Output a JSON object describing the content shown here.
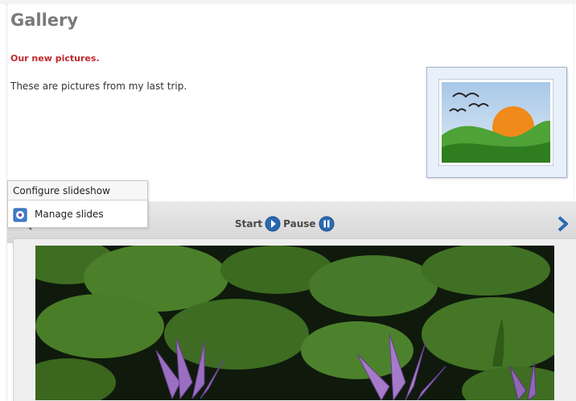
{
  "page": {
    "title": "Gallery",
    "subtitle": "Our new pictures.",
    "description": "These are pictures from my last trip."
  },
  "thumbnail": {
    "icon": "landscape-image-icon"
  },
  "context_menu": {
    "header": "Configure slideshow",
    "items": [
      {
        "label": "Manage slides",
        "icon": "gear-icon"
      }
    ]
  },
  "slideshow": {
    "start_label": "Start",
    "pause_label": "Pause",
    "prev_icon": "chevron-left-icon",
    "next_icon": "chevron-right-icon",
    "start_icon": "play-icon",
    "pause_icon": "pause-icon",
    "image_subject": "water-lily-photo"
  },
  "colors": {
    "title": "#7a7a7a",
    "subtitle": "#c0282d",
    "control_blue": "#2a6ab2",
    "toolbar": "#dcdcdc"
  }
}
